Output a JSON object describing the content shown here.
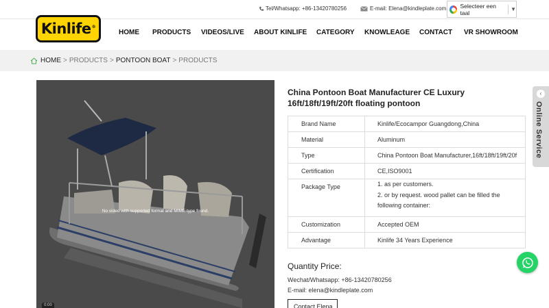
{
  "topbar": {
    "tel": "Tel/Whatsapp: +86-13420780256",
    "email": "E-mail: Elena@kindleplate.com",
    "translate_label": "Selecteer een taal",
    "translate_arrow": "▼"
  },
  "brand": {
    "logo_text": "Kinlife",
    "logo_mark": "®"
  },
  "nav": [
    {
      "label": "HOME"
    },
    {
      "label": "PRODUCTS"
    },
    {
      "label": "VIDEOS/LIVE"
    },
    {
      "label": "ABOUT KINLIFE"
    },
    {
      "label": "CATEGORY"
    },
    {
      "label": "KNOWLEAGE"
    },
    {
      "label": "CONTACT"
    },
    {
      "label": "VR SHOWROOM"
    }
  ],
  "breadcrumb": {
    "home": "HOME",
    "sep": ">",
    "products": "PRODUCTS",
    "pontoon": "PONTOON BOAT",
    "current": "PRODUCTS"
  },
  "media": {
    "no_video_text": "No video with supported format and MIME type found.",
    "time": "0:00"
  },
  "product": {
    "title": "China Pontoon Boat Manufacturer CE Luxury 16ft/18ft/19ft/20ft floating pontoon",
    "specs": [
      {
        "key": "Brand Name",
        "value": "Kinlife/Ecocampor Guangdong,China"
      },
      {
        "key": "Material",
        "value": "Aluminum"
      },
      {
        "key": "Type",
        "value": "China Pontoon Boat Manufacturer,16ft/18ft/19ft/20f"
      },
      {
        "key": "Certification",
        "value": "CE,ISO9001"
      },
      {
        "key": "Package Type",
        "value_line1": "1. as per customers.",
        "value_line2": "2. or by request. wood pallet can be filled the following container:"
      },
      {
        "key": "Customization",
        "value": "Accepted OEM"
      },
      {
        "key": "Advantage",
        "value": "Kinlife 34 Years Experience"
      }
    ],
    "quantity_price_label": "Quantity Price:",
    "wechat": "Wechat/Whatsapp: +86-13420780256",
    "email": "E-mail: elena@kindleplate.com",
    "contact_button": "Contact Elena"
  },
  "side": {
    "online_service": "Online Service",
    "chevron": "‹"
  },
  "colors": {
    "logo_yellow": "#ffd400",
    "whatsapp_green": "#25d366",
    "breadcrumb_bg": "#f1f1f1"
  },
  "icons": [
    "phone-icon",
    "mail-icon",
    "google-icon",
    "home-icon",
    "whatsapp-icon"
  ]
}
